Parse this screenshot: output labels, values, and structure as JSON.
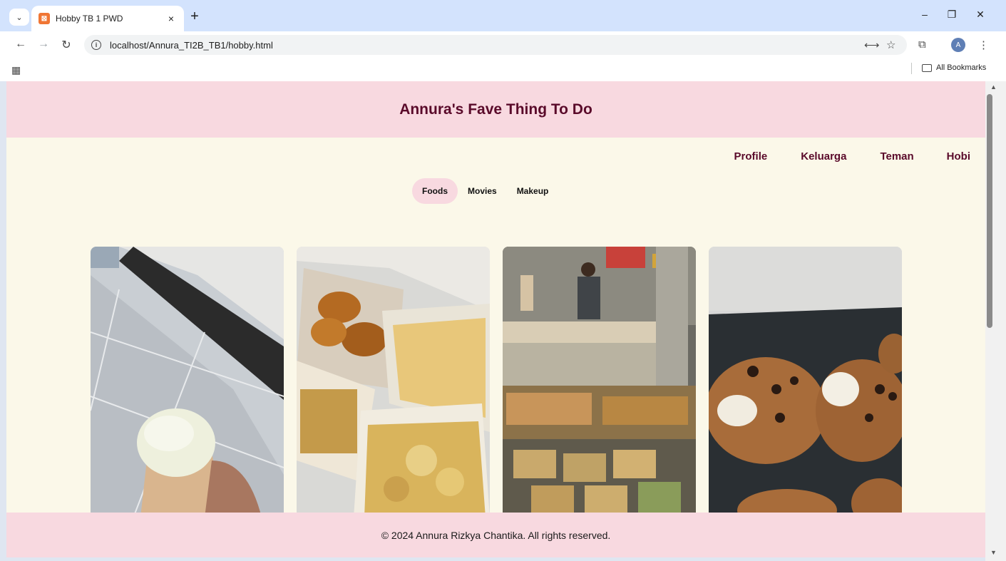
{
  "browser": {
    "tab_title": "Hobby TB 1 PWD",
    "tab_close": "×",
    "new_tab": "+",
    "url": "localhost/Annura_TI2B_TB1/hobby.html",
    "bookmarks_label": "All Bookmarks",
    "avatar_letter": "A",
    "favicon_glyph": "⊠"
  },
  "site": {
    "title": "Annura's Fave Thing To Do",
    "nav": [
      "Profile",
      "Keluarga",
      "Teman",
      "Hobi"
    ],
    "tabs": [
      "Foods",
      "Movies",
      "Makeup"
    ],
    "active_tab": "Foods",
    "footer": "© 2024 Annura Rizkya Chantika. All rights reserved."
  },
  "photos": [
    "ice-cream-cone",
    "fried-snacks-boxes",
    "market-food-stall",
    "chocolate-chip-cookies"
  ],
  "colors": {
    "header_bg": "#f8d9e0",
    "page_bg": "#fbf8e9",
    "title_color": "#5a0a2a"
  }
}
